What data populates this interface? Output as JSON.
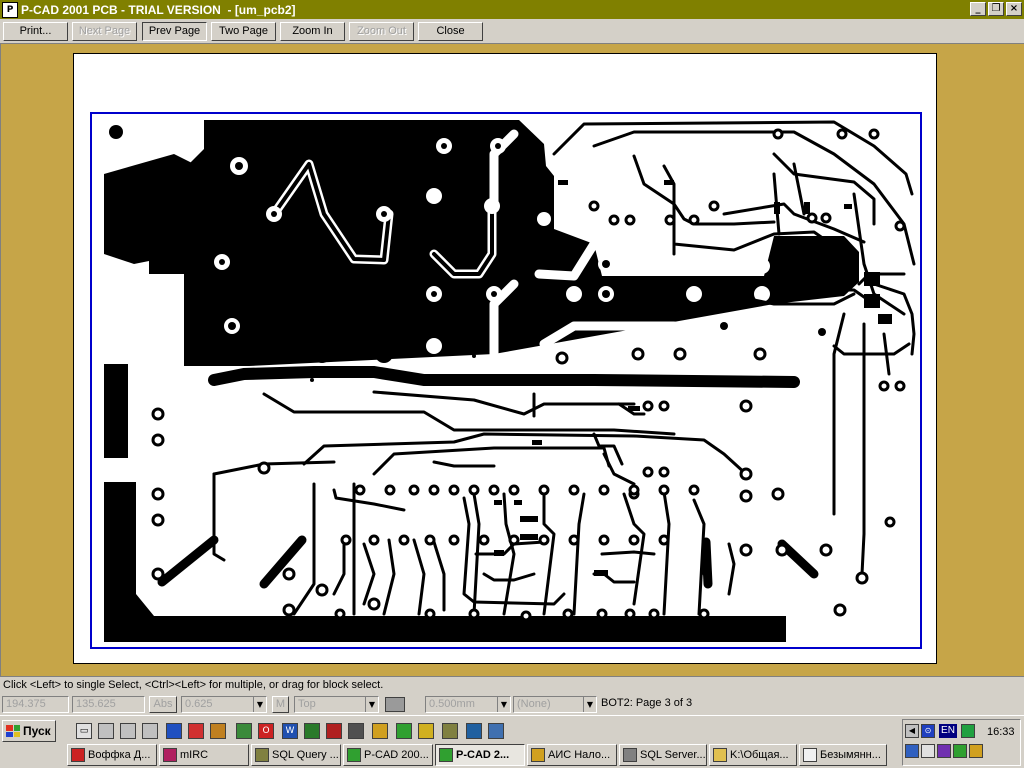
{
  "window": {
    "icon_label": "P",
    "title": "P-CAD 2001 PCB - TRIAL VERSION  - [um_pcb2]",
    "minimize_glyph": "_",
    "restore_glyph": "❐",
    "close_glyph": "×"
  },
  "toolbar": {
    "print_label": "Print...",
    "next_page_label": "Next Page",
    "prev_page_label": "Prev Page",
    "two_page_label": "Two Page",
    "zoom_in_label": "Zoom In",
    "zoom_out_label": "Zoom Out",
    "close_label": "Close"
  },
  "status": {
    "hint": "Click <Left> to single Select, <Ctrl><Left> for multiple, or drag for block select.",
    "coord_x": "194.375",
    "coord_y": "135.625",
    "abs_label": "Abs",
    "grid_value": "0.625",
    "m_label": "M",
    "layer": "Top",
    "line_width": "0.500mm",
    "net": "(None)",
    "page_info": "BOT2: Page 3 of 3"
  },
  "taskbar": {
    "start_label": "Пуск",
    "tasks": [
      {
        "label": "Воффка Д..."
      },
      {
        "label": "mIRC"
      },
      {
        "label": "SQL Query ..."
      },
      {
        "label": "P-CAD 200..."
      },
      {
        "label": "P-CAD 2..."
      },
      {
        "label": "АИС Нало..."
      },
      {
        "label": "SQL Server..."
      },
      {
        "label": "K:\\Общая..."
      },
      {
        "label": "Безымянн..."
      }
    ],
    "lang": "EN",
    "clock": "16:33"
  },
  "colors": {
    "title_bar": "#808000",
    "workspace": "#c6a548",
    "board_outline": "#0000cc",
    "copper": "#000000"
  }
}
